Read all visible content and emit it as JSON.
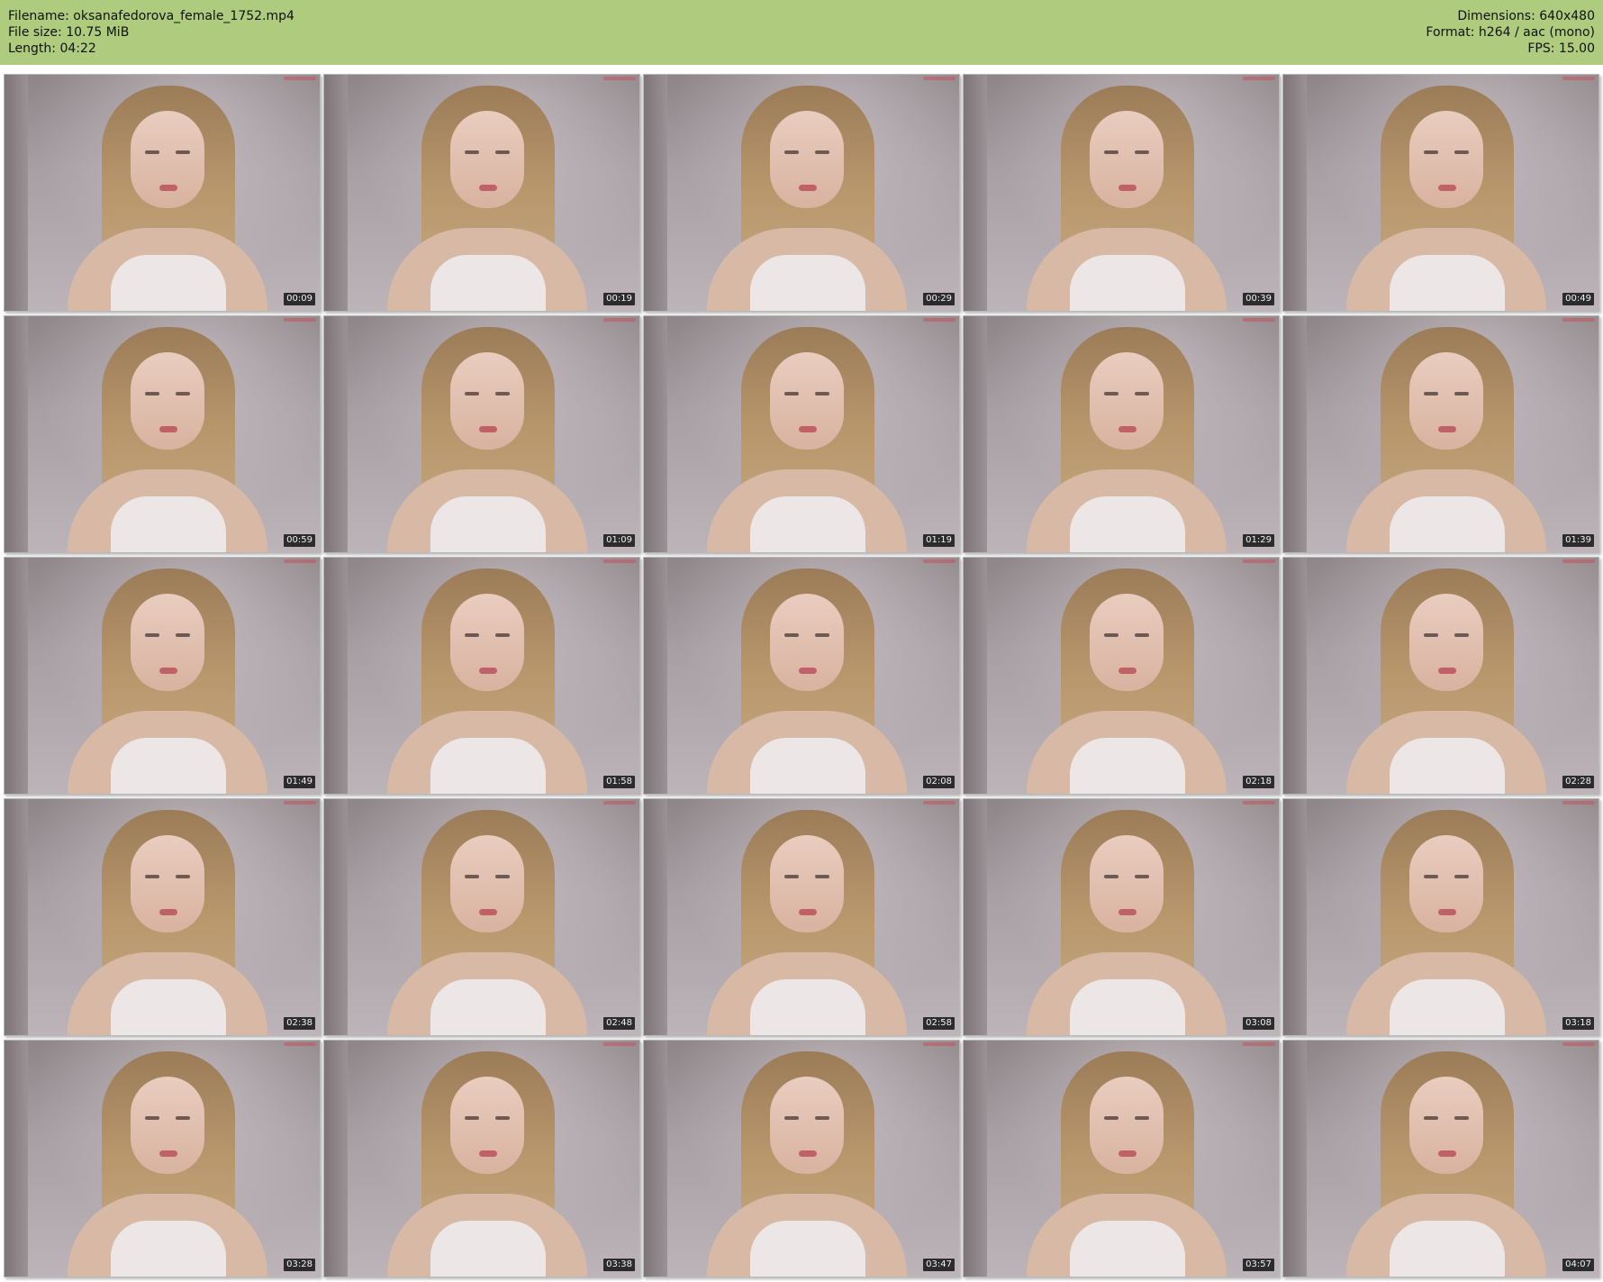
{
  "header": {
    "filename_line": "Filename: oksanafedorova_female_1752.mp4",
    "filesize_line": "File size: 10.75 MiB",
    "length_line": "Length: 04:22",
    "dimensions_line": "Dimensions: 640x480",
    "format_line": "Format: h264 / aac (mono)",
    "fps_line": "FPS: 15.00"
  },
  "thumbnails": [
    {
      "timestamp": "00:09"
    },
    {
      "timestamp": "00:19"
    },
    {
      "timestamp": "00:29"
    },
    {
      "timestamp": "00:39"
    },
    {
      "timestamp": "00:49"
    },
    {
      "timestamp": "00:59"
    },
    {
      "timestamp": "01:09"
    },
    {
      "timestamp": "01:19"
    },
    {
      "timestamp": "01:29"
    },
    {
      "timestamp": "01:39"
    },
    {
      "timestamp": "01:49"
    },
    {
      "timestamp": "01:58"
    },
    {
      "timestamp": "02:08"
    },
    {
      "timestamp": "02:18"
    },
    {
      "timestamp": "02:28"
    },
    {
      "timestamp": "02:38"
    },
    {
      "timestamp": "02:48"
    },
    {
      "timestamp": "02:58"
    },
    {
      "timestamp": "03:08"
    },
    {
      "timestamp": "03:18"
    },
    {
      "timestamp": "03:28"
    },
    {
      "timestamp": "03:38"
    },
    {
      "timestamp": "03:47"
    },
    {
      "timestamp": "03:57"
    },
    {
      "timestamp": "04:07"
    }
  ],
  "colors": {
    "header_background": "#aecb7e",
    "timestamp_background": "#2c2c2c",
    "timestamp_text": "#f2f2f2"
  }
}
